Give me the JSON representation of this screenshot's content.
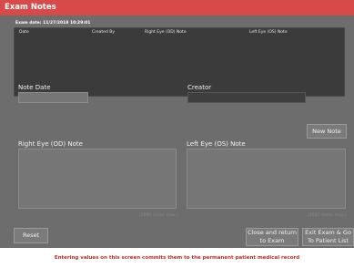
{
  "window": {
    "title": "Exam Notes"
  },
  "exam": {
    "date_label": "Exam date: 11/27/2018 10:29:01"
  },
  "grid": {
    "columns": [
      "Date",
      "Created By",
      "Right Eye (OD) Note",
      "Left Eye (OS) Note"
    ]
  },
  "form": {
    "note_date_label": "Note Date",
    "note_date_value": "",
    "creator_label": "Creator",
    "creator_value": "",
    "right_note_label": "Right Eye (OD) Note",
    "left_note_label": "Left Eye (OS) Note",
    "right_limit": "(2000 chars. max.)",
    "left_limit": "(2000 chars. max.)"
  },
  "buttons": {
    "new_note": "New Note",
    "reset": "Reset",
    "close_return": "Close and return to Exam",
    "exit_exam": "Exit Exam & Go To Patient List"
  },
  "footer": {
    "warning": "Entering values on this screen commits them to the permanent patient medical record"
  },
  "colors": {
    "title_bar": "#d84a4a",
    "panel": "#6d6d6d",
    "grid": "#3b3b3b",
    "warning_text": "#c62828"
  }
}
